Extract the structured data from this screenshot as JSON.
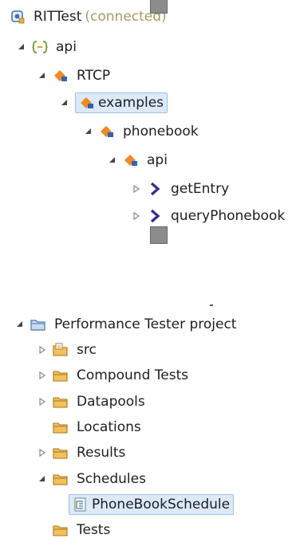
{
  "top_tree": {
    "root": {
      "label": "RITTest",
      "status": "(connected)"
    },
    "items": [
      {
        "label": "api",
        "icon": "bracket-icon",
        "expanded": true
      },
      {
        "label": "RTCP",
        "icon": "package-icon",
        "expanded": true
      },
      {
        "label": "examples",
        "icon": "package-icon",
        "expanded": true,
        "selected": true
      },
      {
        "label": "phonebook",
        "icon": "package-icon",
        "expanded": true
      },
      {
        "label": "api",
        "icon": "package-icon",
        "expanded": true
      },
      {
        "label": "getEntry",
        "icon": "operation-chevron-icon",
        "expanded": false
      },
      {
        "label": "queryPhonebook",
        "icon": "operation-chevron-icon",
        "expanded": false
      }
    ]
  },
  "bottom_tree": {
    "project": {
      "label": "Performance Tester project"
    },
    "items": [
      {
        "label": "src",
        "icon": "source-folder-icon",
        "expanded": false
      },
      {
        "label": "Compound Tests",
        "icon": "folder-icon",
        "expanded": false
      },
      {
        "label": "Datapools",
        "icon": "folder-icon",
        "expanded": false
      },
      {
        "label": "Locations",
        "icon": "folder-icon"
      },
      {
        "label": "Results",
        "icon": "folder-icon",
        "expanded": false
      },
      {
        "label": "Schedules",
        "icon": "folder-icon",
        "expanded": true
      },
      {
        "label": "PhoneBookSchedule",
        "icon": "schedule-file-icon",
        "selected": true
      },
      {
        "label": "Tests",
        "icon": "folder-icon"
      }
    ]
  },
  "colors": {
    "selection_bg": "#dce9f8",
    "selection_border": "#9cc0e6",
    "status_text": "#a79a62",
    "folder": "#e8b04b",
    "package": "#f08a24",
    "operation": "#3a2a8c"
  }
}
